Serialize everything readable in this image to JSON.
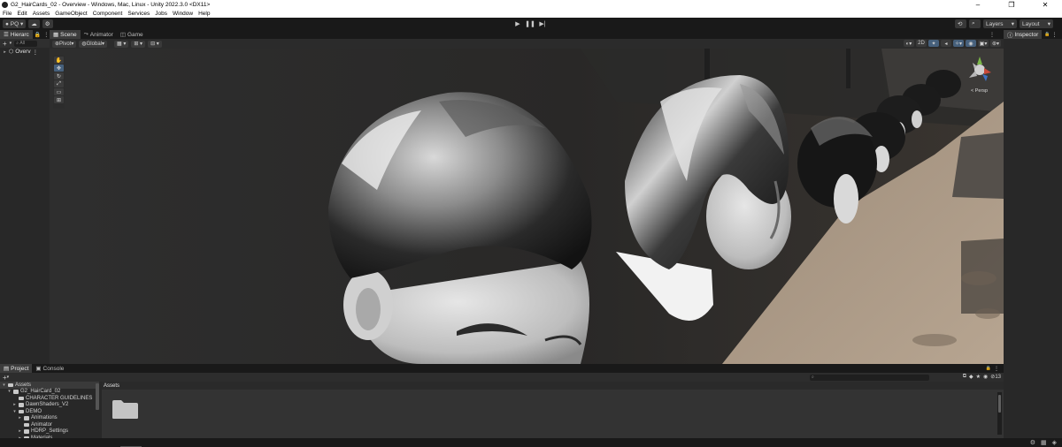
{
  "window": {
    "title": "G2_HairCards_02 - Overview - Windows, Mac, Linux - Unity 2022.3.0 <DX11>",
    "minimize": "–",
    "restore": "❐",
    "close": "✕"
  },
  "menu": [
    "File",
    "Edit",
    "Assets",
    "GameObject",
    "Component",
    "Services",
    "Jobs",
    "Window",
    "Help"
  ],
  "toolbar": {
    "account_label": "PQ",
    "play": "▶",
    "pause": "❚❚",
    "step": "▶|",
    "layers_label": "Layers",
    "layout_label": "Layout"
  },
  "hierarchy": {
    "tab_label": "Hierarc",
    "search_placeholder": "All",
    "root_item": "Overv"
  },
  "scene_tabs": [
    "Scene",
    "Animator",
    "Game"
  ],
  "scene_toolbar": {
    "pivot_label": "Pivot",
    "global_label": "Global",
    "mode_2d": "2D",
    "persp_label": "< Persp"
  },
  "inspector": {
    "tab_label": "Inspector"
  },
  "project": {
    "tabs": [
      "Project",
      "Console"
    ],
    "assets_header": "Assets",
    "visible_count": "13",
    "tree": [
      {
        "label": "Assets",
        "level": 0,
        "expanded": true,
        "selected": true
      },
      {
        "label": "G2_HairCard_02",
        "level": 1,
        "expanded": true,
        "selected": false
      },
      {
        "label": "CHARACTER GUIDELINES",
        "level": 2,
        "expanded": false,
        "selected": false
      },
      {
        "label": "DawnShaders_V2",
        "level": 2,
        "expanded": false,
        "selected": false
      },
      {
        "label": "DEMO",
        "level": 2,
        "expanded": true,
        "selected": false
      },
      {
        "label": "Animations",
        "level": 3,
        "expanded": false,
        "selected": false
      },
      {
        "label": "Animator",
        "level": 3,
        "expanded": false,
        "selected": false
      },
      {
        "label": "HDRP_Settings",
        "level": 3,
        "expanded": false,
        "selected": false
      },
      {
        "label": "Materials",
        "level": 3,
        "expanded": false,
        "selected": false
      }
    ]
  },
  "colors": {
    "accent_blue": "#46607c",
    "panel": "#282828",
    "chrome": "#191919"
  }
}
